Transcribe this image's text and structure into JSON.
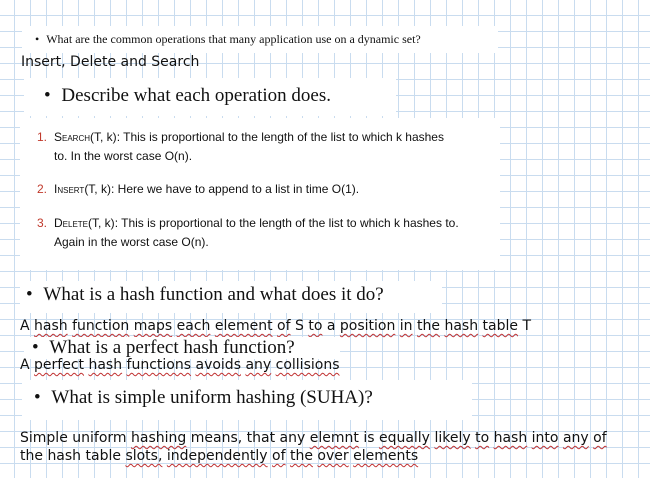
{
  "q1": {
    "text": "What are the common operations that many application use on a dynamic set?"
  },
  "a1": {
    "text": "Insert, Delete and Search"
  },
  "q2": {
    "text": "Describe what each operation does."
  },
  "ops": [
    {
      "num": "1.",
      "name": "Search",
      "args": "(T, k)",
      "line1": ": This is proportional to the length of the list to which k hashes",
      "line2": "to. In the worst case O(n)."
    },
    {
      "num": "2.",
      "name": "Insert",
      "args": "(T, k)",
      "line1": ": Here we have to append to a list in time O(1).",
      "line2": ""
    },
    {
      "num": "3.",
      "name": "Delete",
      "args": "(T, k)",
      "line1": ": This is proportional to the length of the list to which k hashes to.",
      "line2": "Again in the worst case O(n)."
    }
  ],
  "q3": {
    "text": "What is a hash function and what does it do?"
  },
  "a3": {
    "words": [
      "A",
      "hash",
      "function",
      "maps",
      "each",
      "element",
      "of",
      "S",
      "to",
      "a",
      "position",
      "in",
      "the",
      "hash",
      "table",
      "T"
    ]
  },
  "q4": {
    "text": "What is a perfect hash function?"
  },
  "a4": {
    "words": [
      "A",
      "perfect",
      "hash",
      "functions",
      "avoids",
      "any",
      "collisions"
    ]
  },
  "q5": {
    "text": "What is simple uniform hashing (SUHA)?"
  },
  "a5": {
    "line1": [
      "Simple",
      "uniform",
      "hashing",
      "means,",
      "that",
      "any",
      "elemnt",
      "is",
      "equally",
      "likely",
      "to",
      "hash",
      "into",
      "any",
      "of"
    ],
    "line2": [
      "the",
      "hash",
      "table",
      "slots,",
      "independently",
      "of",
      "the",
      "over",
      "elements"
    ]
  },
  "colors": {
    "grid": "#c9dcef",
    "list_number": "#c0392b",
    "spell_underline": "#c03030"
  }
}
